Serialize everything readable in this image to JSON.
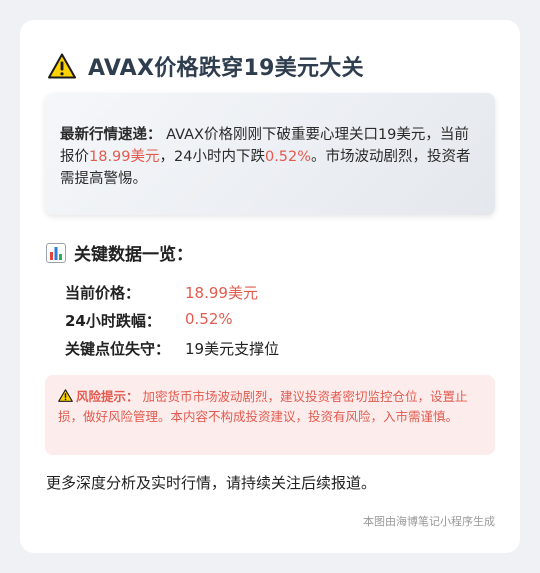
{
  "header": {
    "icon": "warning-icon",
    "title": "AVAX价格跌穿19美元大关"
  },
  "alert": {
    "lead": "最新行情速递：",
    "text_1": " AVAX价格刚刚下破重要心理关口19美元，当前报价",
    "price": "18.99美元",
    "text_2": "，24小时内下跌",
    "change": "0.52%",
    "text_3": "。市场波动剧烈，投资者需提高警惕。"
  },
  "key_data": {
    "icon": "bar-chart-icon",
    "title": "关键数据一览：",
    "rows": [
      {
        "label": "当前价格：",
        "value": "18.99美元",
        "highlight": true
      },
      {
        "label": "24小时跌幅：",
        "value": "0.52%",
        "highlight": true
      },
      {
        "label": "关键点位失守：",
        "value": "19美元支撑位",
        "highlight": false
      }
    ]
  },
  "risk": {
    "icon": "warning-icon",
    "head": "风险提示：",
    "text": "加密货币市场波动剧烈，建议投资者密切监控仓位，设置止损，做好风险管理。本内容不构成投资建议，投资有风险，入市需谨慎。"
  },
  "more": "更多深度分析及实时行情，请持续关注后续报道。",
  "footer": "本图由海博笔记小程序生成",
  "colors": {
    "accent_red": "#e35b4f",
    "title": "#2f3e4e",
    "risk_bg": "#fdecec"
  }
}
